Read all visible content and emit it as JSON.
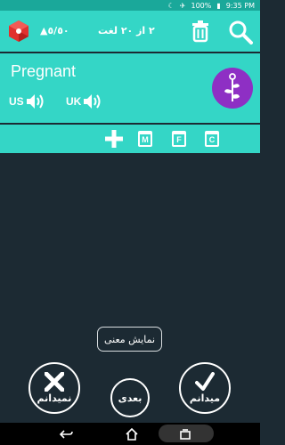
{
  "status_bar": {
    "battery": "100%",
    "time": "9:35 PM"
  },
  "header": {
    "score": "▲٥/٥٠",
    "counter": "۲ از ۲۰ لغت"
  },
  "card": {
    "word": "Pregnant",
    "us_label": "US",
    "uk_label": "UK"
  },
  "tools": {
    "m_label": "M",
    "f_label": "F",
    "c_label": "C"
  },
  "buttons": {
    "show_meaning": "نمایش معنی",
    "dont_know": "نمیدانم",
    "next": "بعدی",
    "know": "میدانم"
  },
  "colors": {
    "accent": "#34d6c6",
    "background": "#1c2a33",
    "plant_badge": "#8e2fc4",
    "gem": "#e0312f"
  }
}
